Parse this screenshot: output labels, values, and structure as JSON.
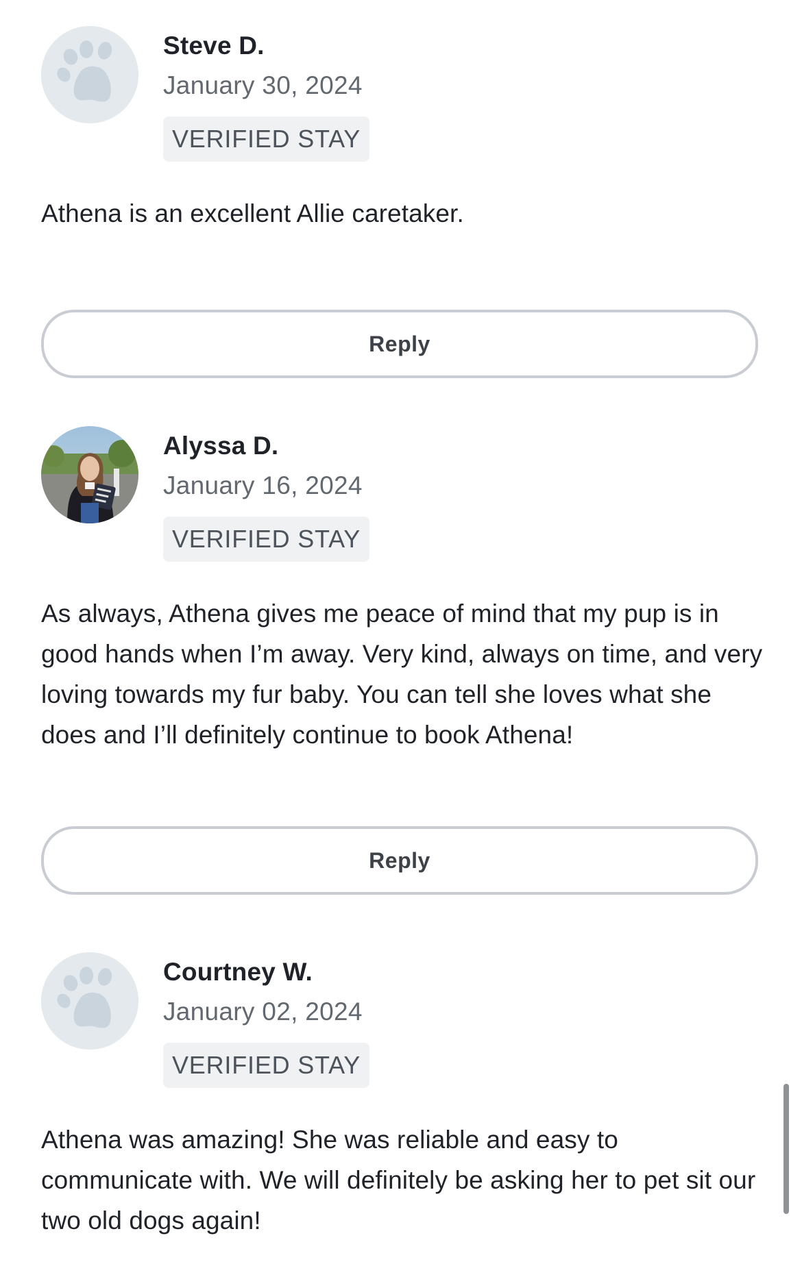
{
  "reviews": [
    {
      "name": "Steve D.",
      "date": "January 30, 2024",
      "badge": "VERIFIED STAY",
      "avatar": "paw-placeholder-icon",
      "text": "Athena is an excellent Allie caretaker.",
      "reply_label": "Reply"
    },
    {
      "name": "Alyssa D.",
      "date": "January 16, 2024",
      "badge": "VERIFIED STAY",
      "avatar": "profile-photo",
      "text": "As always, Athena gives me peace of mind that my pup is in good hands when I’m away. Very kind, always on time, and very loving towards my fur baby. You can tell she loves what she does and I’ll definitely continue to book Athena!",
      "reply_label": "Reply"
    },
    {
      "name": "Courtney W.",
      "date": "January 02, 2024",
      "badge": "VERIFIED STAY",
      "avatar": "paw-placeholder-icon",
      "text": "Athena was amazing! She was reliable and easy to communicate with. We will definitely be asking her to pet sit our two old dogs again!"
    }
  ],
  "colors": {
    "avatar_bg": "#e4e9ee",
    "paw": "#c9d4dd",
    "badge_bg": "#eff1f3",
    "reply_border": "#c9ccd3",
    "text": "#1f2329",
    "muted": "#62686f"
  }
}
